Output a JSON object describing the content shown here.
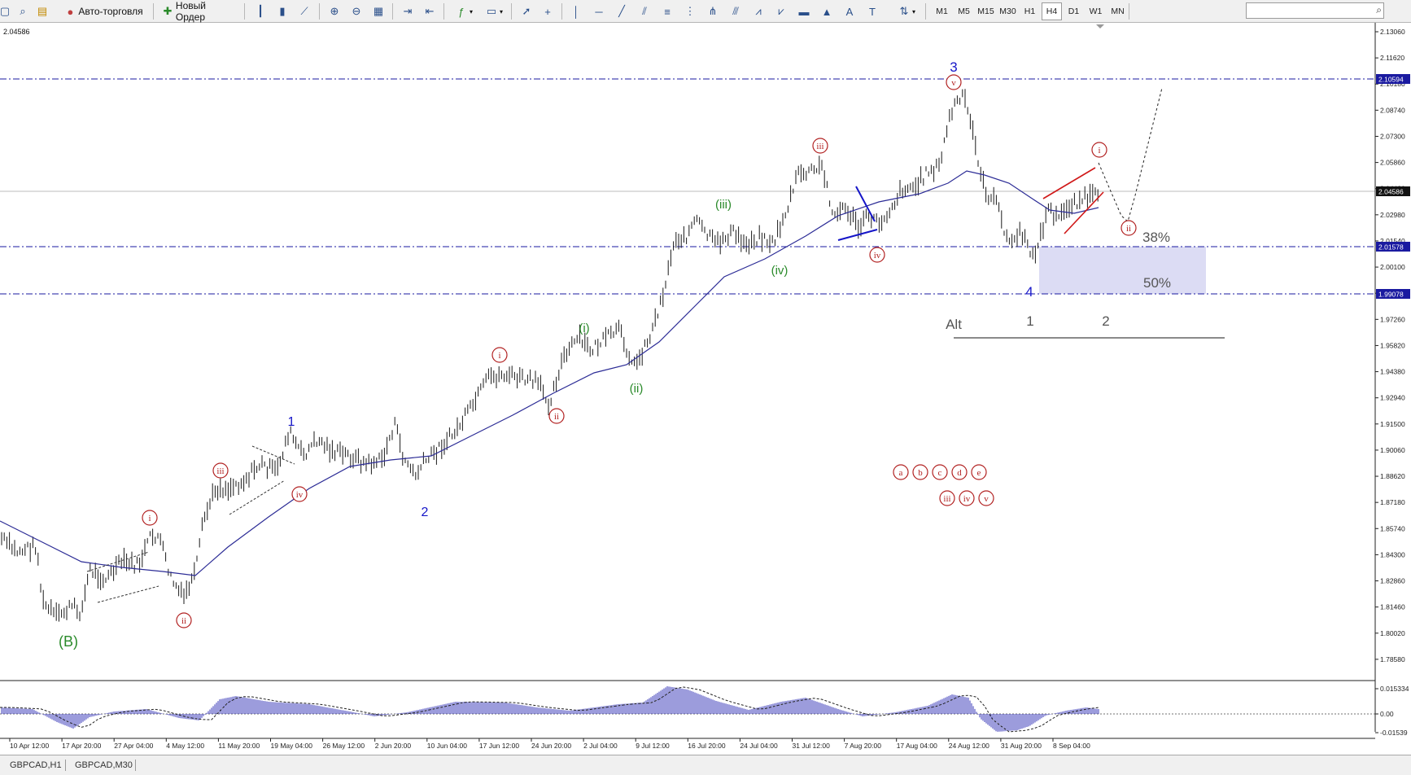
{
  "toolbar": {
    "auto_trading_label": "Авто-торговля",
    "new_order_label": "Новый Ордер",
    "timeframes": [
      "M1",
      "M5",
      "M15",
      "M30",
      "H1",
      "H4",
      "D1",
      "W1",
      "MN"
    ],
    "active_timeframe": "H4"
  },
  "chart": {
    "symbol_price_label": "2.04586",
    "price_ticks": [
      "2.13060",
      "2.11620",
      "2.10180",
      "2.08740",
      "2.07300",
      "2.05860",
      "2.04420",
      "2.02980",
      "2.01540",
      "2.00100",
      "1.98700",
      "1.97260",
      "1.95820",
      "1.94380",
      "1.92940",
      "1.91500",
      "1.90060",
      "1.88620",
      "1.87180",
      "1.85740",
      "1.84300",
      "1.82860",
      "1.81460",
      "1.80020",
      "1.78580"
    ],
    "price_tags": {
      "top": "2.10594",
      "bid": "2.04586",
      "level_38": "2.01578",
      "level_50": "1.99078"
    },
    "date_labels": [
      "10 Apr 12:00",
      "17 Apr 20:00",
      "27 Apr 04:00",
      "4 May 12:00",
      "11 May 20:00",
      "19 May 04:00",
      "26 May 12:00",
      "2 Jun 20:00",
      "10 Jun 04:00",
      "17 Jun 12:00",
      "24 Jun 20:00",
      "2 Jul 04:00",
      "9 Jul 12:00",
      "16 Jul 20:00",
      "24 Jul 04:00",
      "31 Jul 12:00",
      "7 Aug 20:00",
      "17 Aug 04:00",
      "24 Aug 12:00",
      "31 Aug 20:00",
      "8 Sep 04:00"
    ],
    "osc_ticks": [
      "0.015334",
      "0.00",
      "-0.01539"
    ],
    "annotations": {
      "wave_B": "(B)",
      "blue_1": "1",
      "blue_2": "2",
      "blue_3": "3",
      "blue_4": "4",
      "red_i": "i",
      "red_ii": "ii",
      "red_iii": "iii",
      "red_iv": "iv",
      "red_v": "v",
      "green_i": "(i)",
      "green_ii": "(ii)",
      "green_iii": "(iii)",
      "green_iv": "(iv)",
      "fib_38": "38%",
      "fib_50": "50%",
      "alt": "Alt",
      "alt_1": "1",
      "alt_2": "2",
      "legend_letters": [
        "a",
        "b",
        "c",
        "d",
        "e"
      ],
      "legend_numerals": [
        "iii",
        "iv",
        "v"
      ]
    },
    "colors": {
      "wave_red": "#b22222",
      "wave_blue": "#1515c8",
      "wave_green": "#2a8a2a",
      "level_line": "#1a1aa0",
      "zone": "#dcdcf4",
      "ma": "#2c2c96",
      "bars": "#1a1a1a",
      "osc": "#3a3ab8"
    }
  },
  "tabs": [
    "GBPCAD,H1",
    "GBPCAD,M30"
  ],
  "active_tab": "GBPCAD,H1"
}
